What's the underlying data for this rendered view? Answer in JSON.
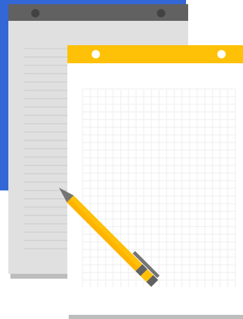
{
  "illustration": {
    "colors": {
      "back_card": "#3367d6",
      "notepad_header": "#616161",
      "notepad_body": "#e0e0e0",
      "notepad_lines": "#cfcfcf",
      "grid_header": "#ffc107",
      "grid_body": "#ffffff",
      "grid_lines": "#eeeeee",
      "pencil_body": "#ffc107",
      "pencil_dark": "#757575",
      "shadow": "#bdbdbd"
    },
    "icons": [
      "notepad-icon",
      "grid-paper-icon",
      "pencil-icon"
    ]
  }
}
